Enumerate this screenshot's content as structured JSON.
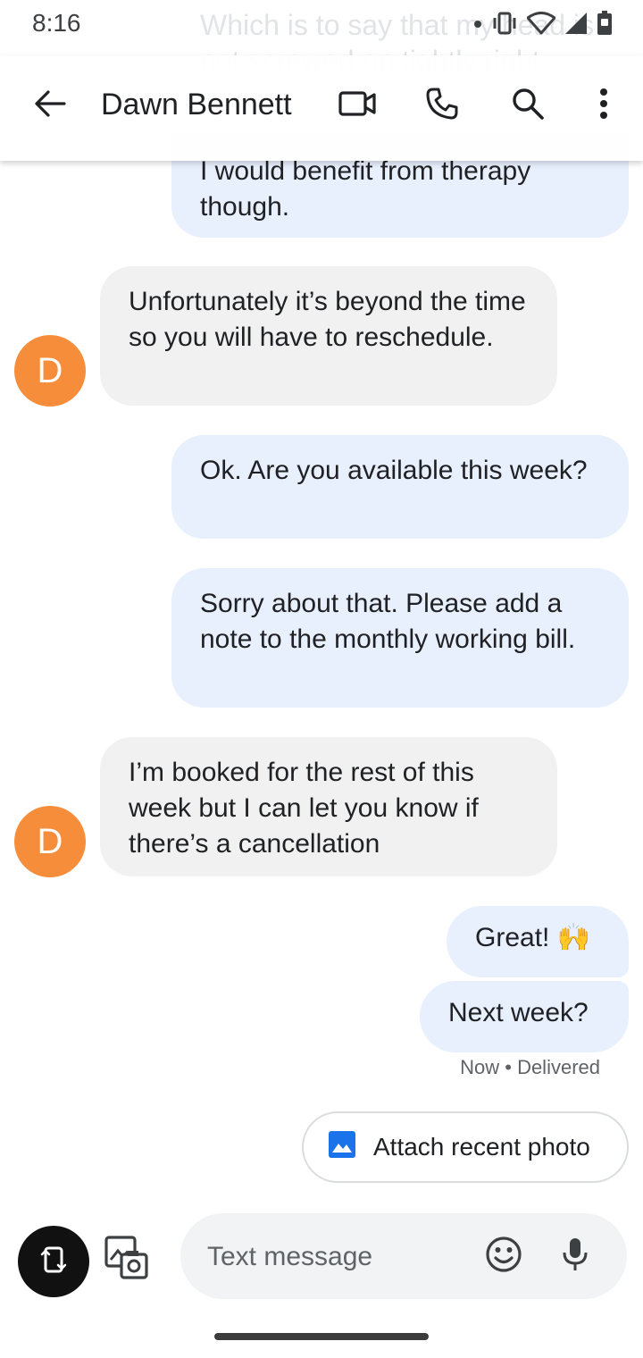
{
  "status": {
    "time": "8:16"
  },
  "notification_ghost": "Which is to say that my head is not screwed on tightly right",
  "appbar": {
    "title": "Dawn Bennett",
    "icons": [
      "back-arrow-icon",
      "video-call-icon",
      "phone-icon",
      "search-icon",
      "more-vert-icon"
    ]
  },
  "messages": [
    {
      "dir": "out",
      "text": "I would benefit from therapy though."
    },
    {
      "dir": "in",
      "avatar": "D",
      "text": "Unfortunately it’s beyond the time so you will have to reschedule."
    },
    {
      "dir": "out",
      "text": "Ok. Are you available this week?"
    },
    {
      "dir": "out",
      "text": "Sorry about that. Please add a note to the monthly working bill."
    },
    {
      "dir": "in",
      "avatar": "D",
      "text": "I’m booked for the rest of this week but I can let you know if there’s a cancellation"
    },
    {
      "dir": "out",
      "text": "Great! 🙌"
    },
    {
      "dir": "out",
      "text": "Next week?"
    }
  ],
  "delivery_status": "Now • Delivered",
  "attach_chip": {
    "label": "Attach recent photo"
  },
  "compose": {
    "placeholder": "Text message"
  },
  "colors": {
    "accent": "#1a73e8",
    "avatar": "#f58d3b",
    "outgoing_bubble": "#e8effd",
    "incoming_bubble": "#f1f1f1"
  }
}
